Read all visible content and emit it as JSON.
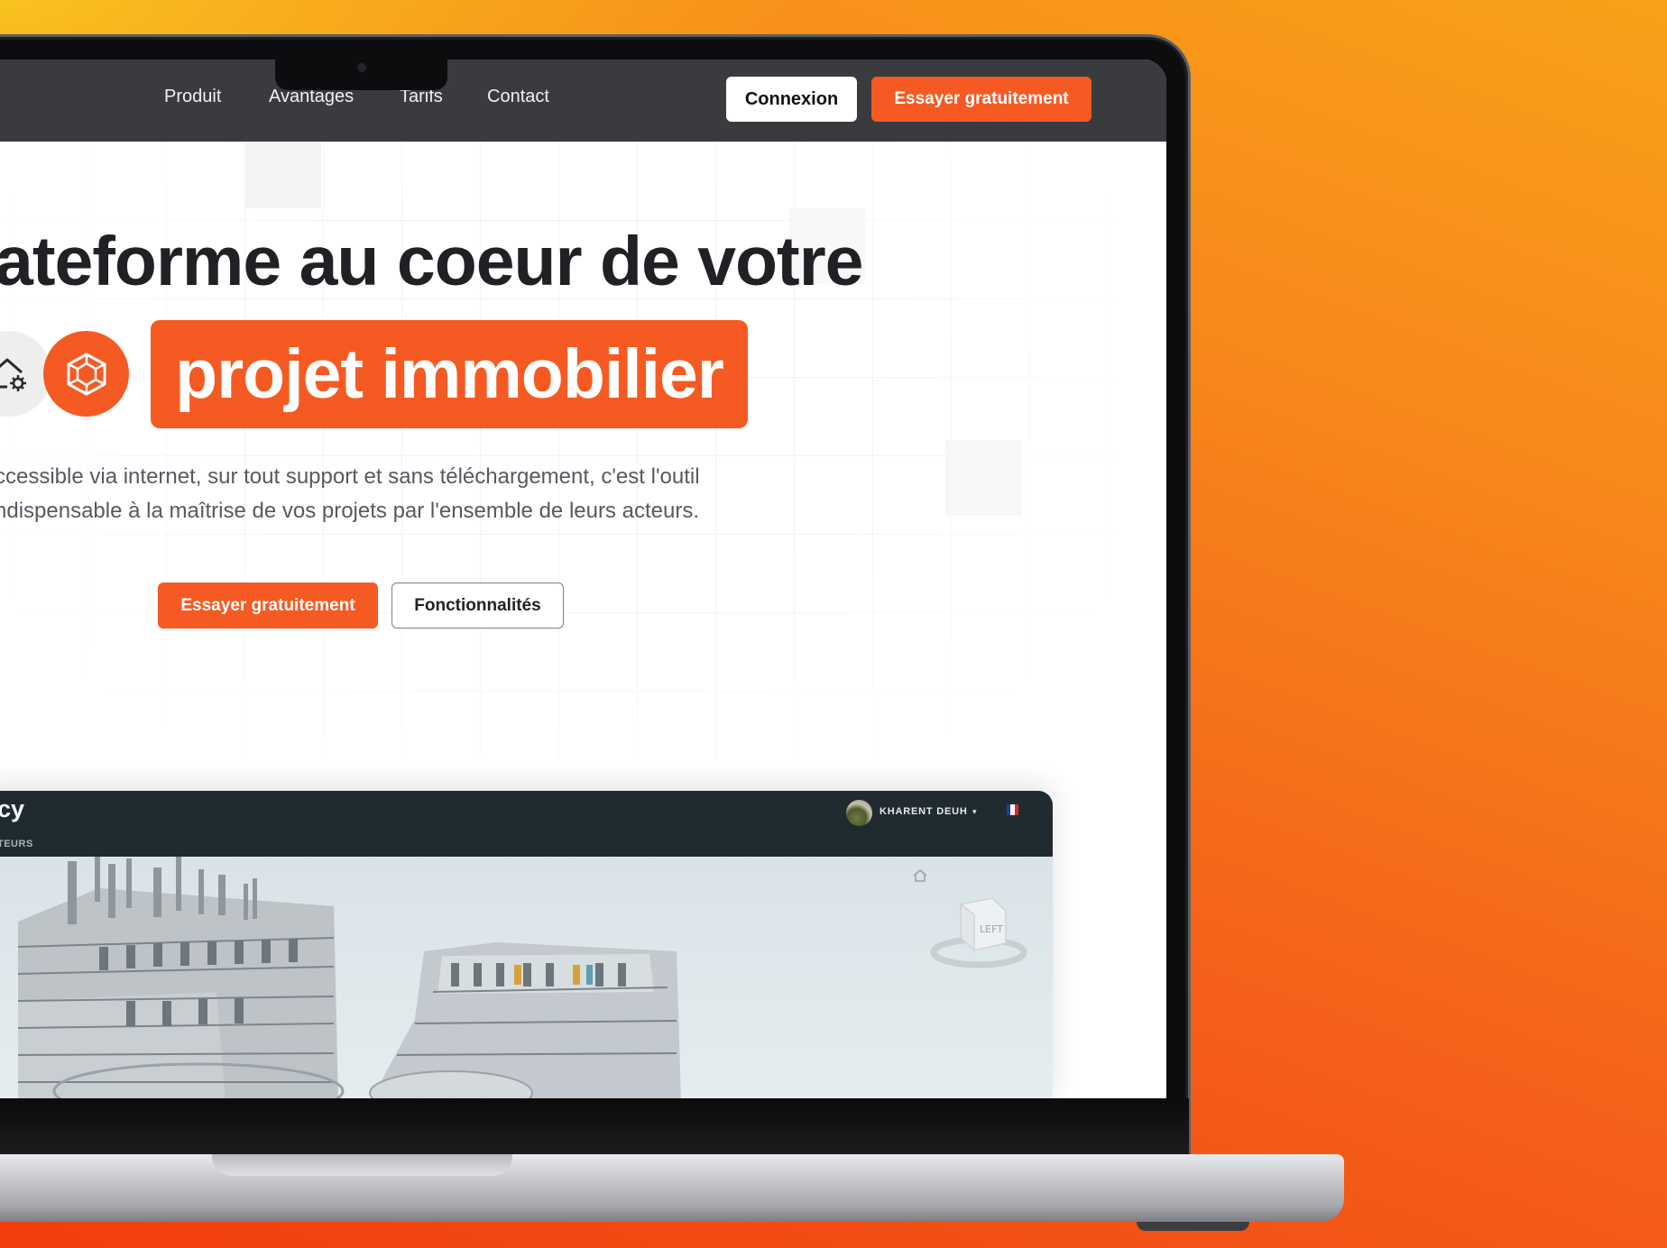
{
  "nav": {
    "links": [
      "Produit",
      "Avantages",
      "Tarifs",
      "Contact"
    ],
    "login": "Connexion",
    "try": "Essayer gratuitement"
  },
  "hero": {
    "headline_line1": "ateforme au coeur de votre",
    "highlight": "projet immobilier",
    "description_line1": "ccessible via internet, sur tout support et sans téléchargement, c'est l'outil",
    "description_line2": "ndispensable à la maîtrise de vos projets par l'ensemble de leurs acteurs.",
    "cta_primary": "Essayer gratuitement",
    "cta_secondary": "Fonctionnalités"
  },
  "preview": {
    "app_name": "cy",
    "app_sub": "TEURS",
    "user_name": "KHARENT DEUH",
    "caret": "▾",
    "viewcube_label": "LEFT"
  },
  "colors": {
    "accent": "#f65a23",
    "nav_bg": "#3a3b3f",
    "app_header_bg": "#202b31"
  },
  "icons": [
    "house-settings-icon",
    "cube-network-icon",
    "home-icon",
    "viewcube-icon",
    "flag-fr-icon",
    "avatar"
  ]
}
